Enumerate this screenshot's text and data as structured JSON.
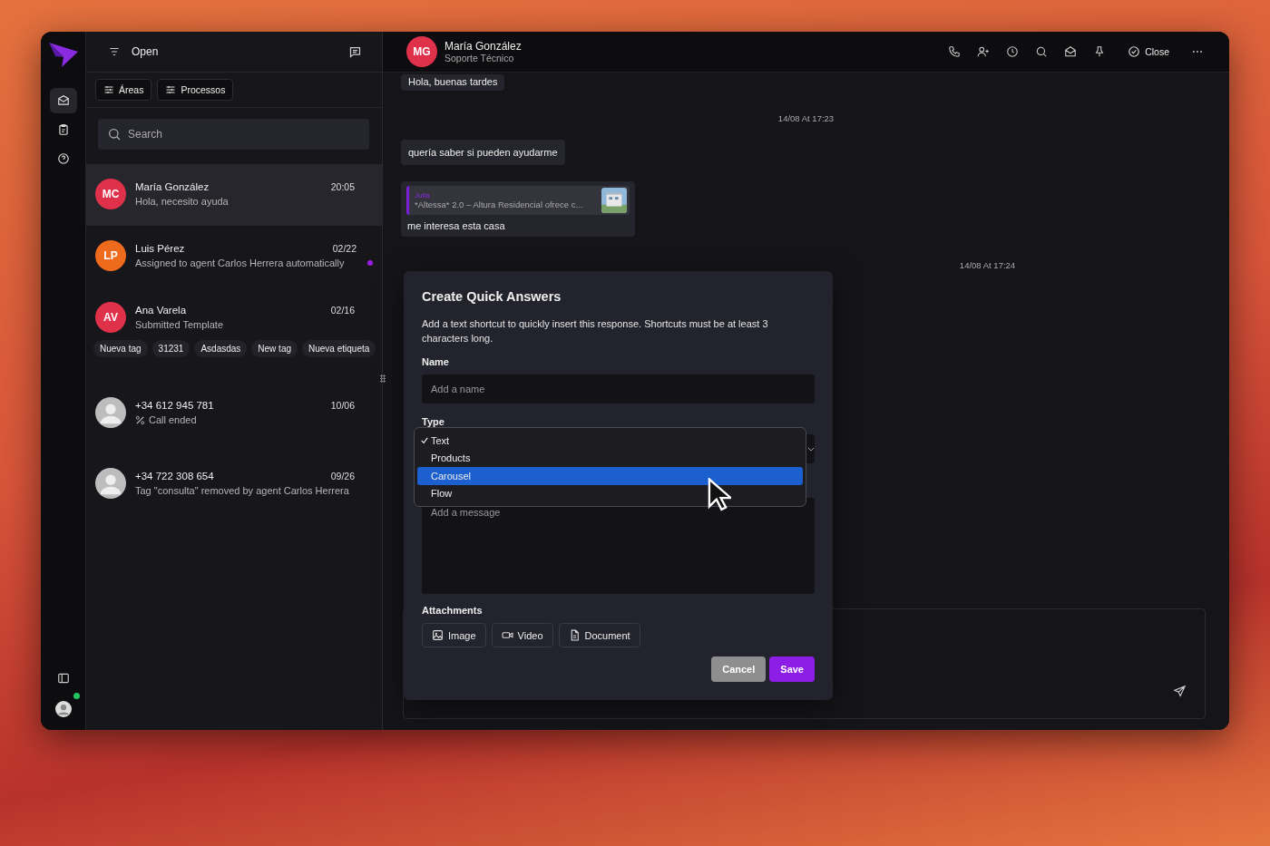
{
  "rail": {
    "items": [
      {
        "selected": true
      },
      {
        "selected": false
      },
      {
        "selected": false
      }
    ],
    "user": {
      "online": true
    }
  },
  "list": {
    "filter": "Open",
    "chips": [
      "Áreas",
      "Processos"
    ],
    "search": {
      "placeholder": "Search"
    },
    "conversations": [
      {
        "kind": "message",
        "initials": "MC",
        "color": "#e0314b",
        "name": "María González",
        "date": "20:05",
        "preview": "Hola, necesito ayuda",
        "unread": false,
        "selected": true
      },
      {
        "kind": "message",
        "initials": "LP",
        "color": "#ee6a1c",
        "name": "Luis Pérez",
        "date": "02/22",
        "preview": "Assigned to agent Carlos Herrera automatically",
        "unread": true,
        "selected": false
      },
      {
        "kind": "message",
        "initials": "AV",
        "color": "#e0314b",
        "name": "Ana Varela",
        "date": "02/16",
        "preview": "Submitted Template",
        "unread": false,
        "selected": false,
        "tags": [
          "Nueva tag",
          "31231",
          "Asdasdas",
          "New tag",
          "Nueva etiqueta"
        ]
      },
      {
        "kind": "call",
        "name": "+34 612 945 781",
        "date": "10/06",
        "preview": "Call ended",
        "unread": false,
        "selected": false
      },
      {
        "kind": "message",
        "name": "+34 722 308 654",
        "date": "09/26",
        "preview": "Tag \"consulta\" removed by agent Carlos Herrera",
        "unread": false,
        "selected": false
      }
    ]
  },
  "chat": {
    "contact": {
      "initials": "MG",
      "name": "María González",
      "subtitle": "Soporte Técnico"
    },
    "close": "Close",
    "messages": [
      {
        "kind": "bubble",
        "text": "Hola, buenas tardes"
      },
      {
        "kind": "time",
        "text": "14/08 At 17:23"
      },
      {
        "kind": "bubble",
        "text": "quería saber si pueden ayudarme"
      },
      {
        "kind": "quote",
        "author": "Julia",
        "quote": "*Altessa* 2.0 – Altura Residencial ofrece c...",
        "text": "me interesa esta casa"
      },
      {
        "kind": "time",
        "text": "14/08 At 17:24"
      }
    ]
  },
  "dialog": {
    "title": "Create Quick Answers",
    "description": "Add a text shortcut to quickly insert this response. Shortcuts must be at least 3 characters long.",
    "name": {
      "label": "Name",
      "placeholder": "Add a name"
    },
    "type": {
      "label": "Type",
      "options": [
        {
          "label": "Text",
          "checked": true,
          "selected": false
        },
        {
          "label": "Products",
          "checked": false,
          "selected": false
        },
        {
          "label": "Carousel",
          "checked": false,
          "selected": true
        },
        {
          "label": "Flow",
          "checked": false,
          "selected": false
        }
      ]
    },
    "message": {
      "placeholder": "Add a message"
    },
    "attachments": {
      "label": "Attachments",
      "buttons": [
        "Image",
        "Video",
        "Document"
      ]
    },
    "cancel": {
      "label": "Cancel",
      "disabled": true
    },
    "save": {
      "label": "Save"
    }
  }
}
